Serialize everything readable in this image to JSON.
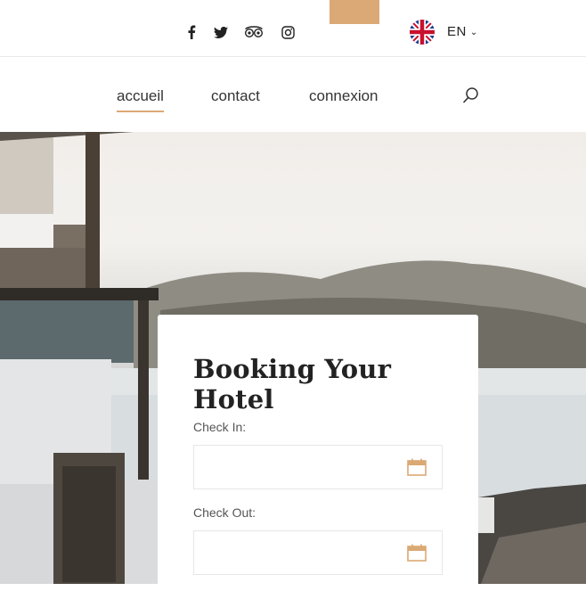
{
  "header": {
    "social_icons": [
      "facebook-icon",
      "twitter-icon",
      "tripadvisor-icon",
      "instagram-icon"
    ],
    "language": {
      "code": "EN",
      "flag": "uk-flag-icon"
    }
  },
  "nav": {
    "items": [
      {
        "label": "accueil",
        "active": true
      },
      {
        "label": "contact",
        "active": false
      },
      {
        "label": "connexion",
        "active": false
      }
    ],
    "search_icon": "search-icon"
  },
  "booking": {
    "title": "Booking Your Hotel",
    "check_in_label": "Check In:",
    "check_in_value": "",
    "check_out_label": "Check Out:",
    "check_out_value": ""
  },
  "colors": {
    "accent": "#dba975",
    "text": "#333333"
  }
}
